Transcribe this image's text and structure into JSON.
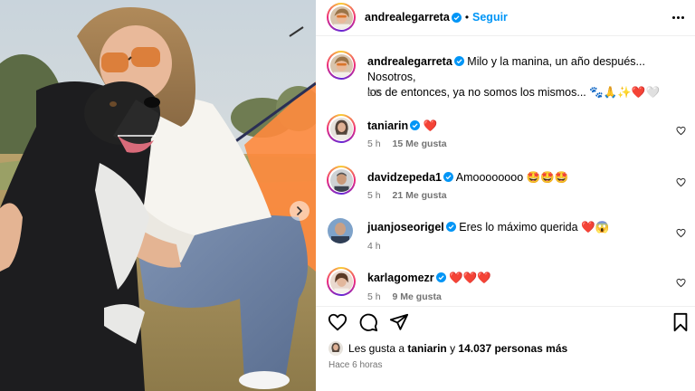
{
  "post": {
    "author": "andrealegarreta",
    "follow_label": "Seguir",
    "caption_user": "andrealegarreta",
    "caption_text_1": "Milo y la manina, un año después... Nosotros,",
    "caption_text_2": "los de entonces, ya no somos los mismos... 🐾🙏✨❤️🤍",
    "caption_time": "6 h"
  },
  "comments": [
    {
      "user": "taniarin",
      "text": "❤️",
      "time": "5 h",
      "likes": "15 Me gusta"
    },
    {
      "user": "davidzepeda1",
      "text": "Amoooooooo 🤩🤩🤩",
      "time": "5 h",
      "likes": "21 Me gusta"
    },
    {
      "user": "juanjoseorigel",
      "text": "Eres lo máximo querida ❤️😱",
      "time": "4 h",
      "likes": ""
    },
    {
      "user": "karlagomezr",
      "text": "❤️❤️❤️",
      "time": "5 h",
      "likes": "9 Me gusta"
    }
  ],
  "footer": {
    "likes_prefix": "Les gusta a",
    "likes_user": "taniarin",
    "likes_middle": "y",
    "likes_count": "14.037 personas más",
    "time_ago": "Hace 6 horas"
  },
  "icons": {
    "more": "more-options-icon",
    "heart": "heart-icon",
    "comment": "comment-icon",
    "share": "share-icon",
    "save": "bookmark-icon",
    "verified": "verified-badge-icon",
    "carousel": "chevron-right-icon"
  },
  "colors": {
    "accent": "#0095f6",
    "verified": "#0095f6",
    "heart": "#e0152b",
    "muted": "#737373"
  }
}
